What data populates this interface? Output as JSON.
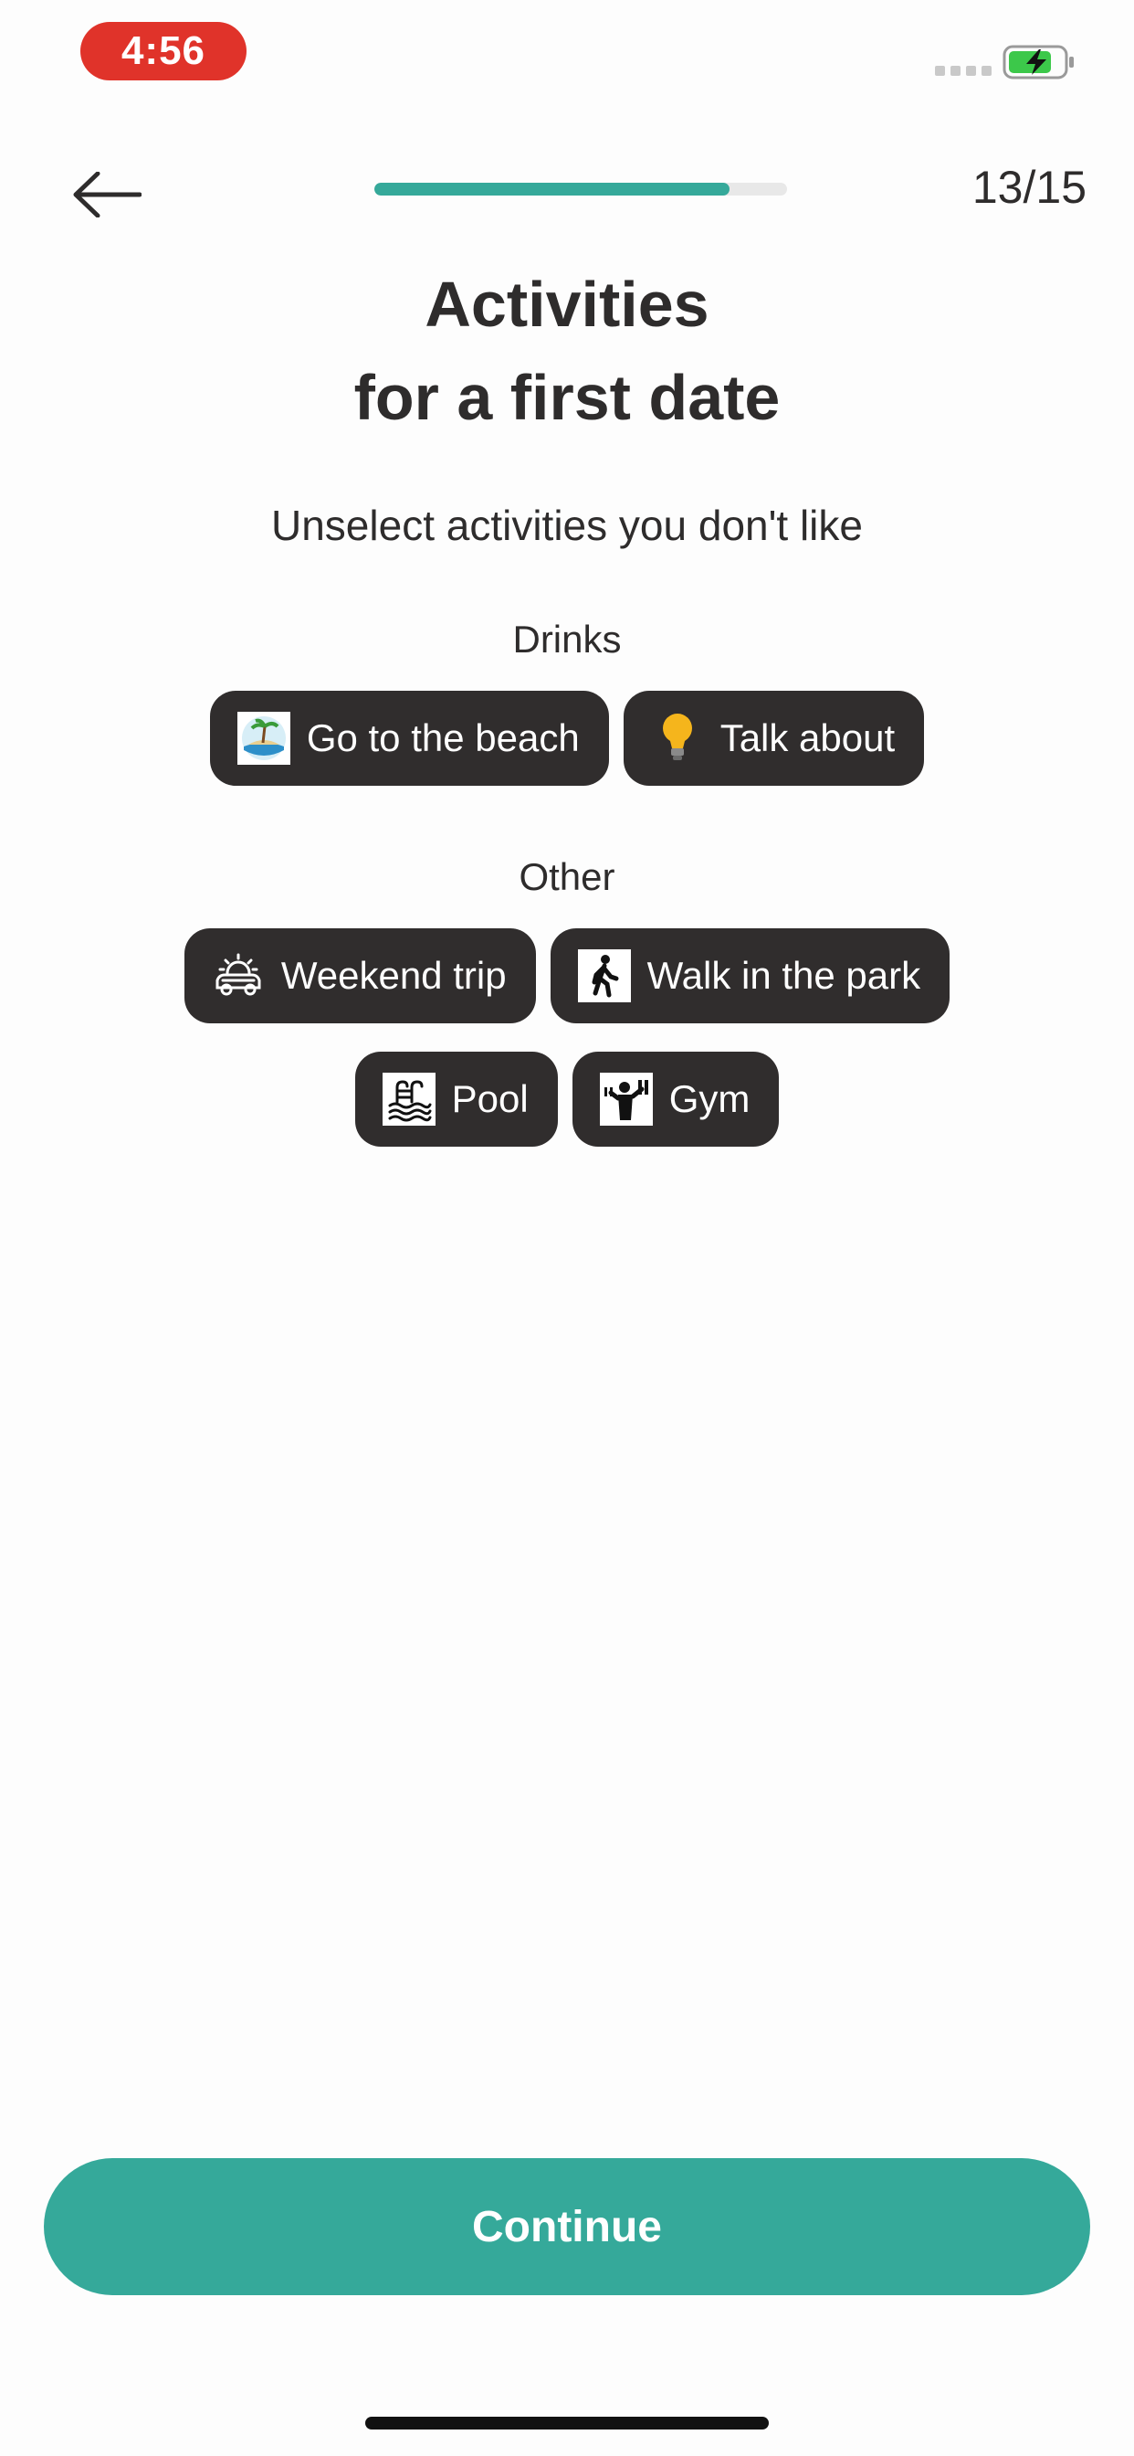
{
  "status_bar": {
    "time": "4:56",
    "battery_level": 0.8,
    "charging": true
  },
  "header": {
    "progress": 0.86,
    "step_counter": "13/15"
  },
  "title_lines": [
    "Activities",
    "for a first date"
  ],
  "subtitle": "Unselect activities you don't like",
  "sections": [
    {
      "label": "Drinks",
      "chips": [
        {
          "label": "Go to the beach",
          "icon": "beach-icon"
        },
        {
          "label": "Talk about",
          "icon": "lightbulb-icon"
        }
      ]
    },
    {
      "label": "Other",
      "chips": [
        {
          "label": "Weekend trip",
          "icon": "car-sunrise-icon"
        },
        {
          "label": "Walk in the park",
          "icon": "walking-person-icon"
        },
        {
          "label": "Pool",
          "icon": "pool-icon"
        },
        {
          "label": "Gym",
          "icon": "weightlifter-icon"
        }
      ]
    }
  ],
  "continue_label": "Continue",
  "colors": {
    "accent": "#35a99a",
    "chip_bg": "#302d2d",
    "time_pill": "#e0332a"
  }
}
